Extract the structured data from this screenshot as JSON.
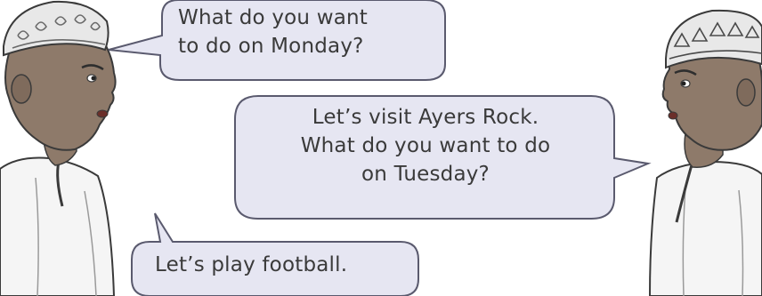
{
  "dialogue": {
    "bubble1": {
      "speaker": "boy-left",
      "lines": [
        "What do you want",
        "to do on Monday?"
      ]
    },
    "bubble2": {
      "speaker": "boy-right",
      "lines": [
        "Let’s visit Ayers Rock.",
        "What do you want to do",
        "on Tuesday?"
      ]
    },
    "bubble3": {
      "speaker": "boy-left",
      "lines": [
        "Let’s play football."
      ]
    }
  },
  "colors": {
    "bubble_fill": "#e6e6f2",
    "bubble_stroke": "#5a5a6e",
    "skin": "#8e7a6a",
    "robe": "#f5f5f5",
    "cap": "#e8e8e8",
    "outline": "#3a3a3a"
  },
  "characters": {
    "left": "boy-with-embroidered-cap-icon",
    "right": "boy-with-embroidered-cap-icon"
  }
}
